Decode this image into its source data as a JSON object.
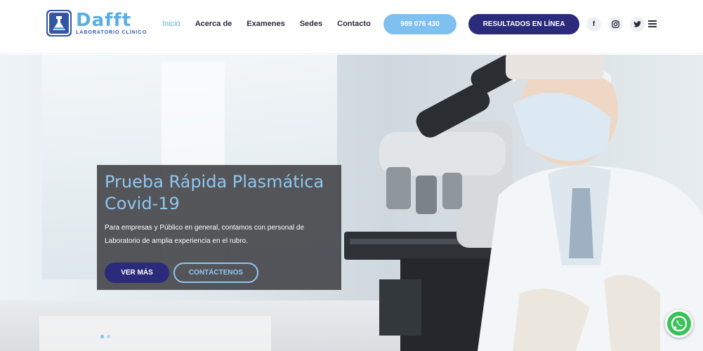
{
  "brand": {
    "name": "Dafft",
    "tagline": "LABORATORIO CLÍNICO",
    "accent": "#5aaee3",
    "primary": "#2c2a7a"
  },
  "nav": {
    "items": [
      {
        "label": "Inicio",
        "active": true
      },
      {
        "label": "Acerca de",
        "active": false
      },
      {
        "label": "Examenes",
        "active": false
      },
      {
        "label": "Sedes",
        "active": false
      },
      {
        "label": "Contacto",
        "active": false
      }
    ]
  },
  "header": {
    "phone": "989 076 430",
    "results": "RESULTADOS EN LÍNEA"
  },
  "social": {
    "facebook": "f",
    "instagram": "instagram-icon",
    "twitter": "twitter-icon"
  },
  "hero": {
    "title": "Prueba Rápida Plasmática Covid-19",
    "description": "Para empresas y Público en general, contamos con personal de Laboratorio de amplia experiencia en el rubro.",
    "btn_more": "VER MÁS",
    "btn_contact": "CONTÁCTENOS",
    "slides_total": 2,
    "slide_active": 1
  }
}
